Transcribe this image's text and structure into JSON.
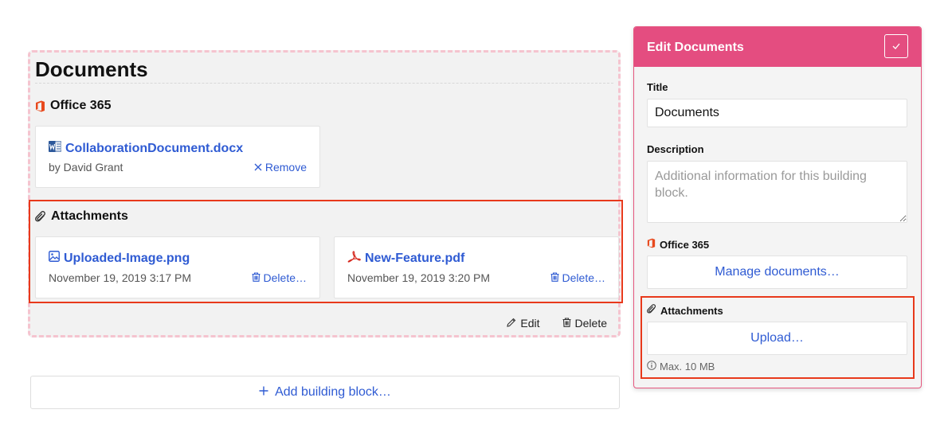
{
  "documents_block": {
    "title": "Documents",
    "office_section": {
      "heading": "Office 365",
      "icon": "office-365-icon",
      "items": [
        {
          "name": "CollaborationDocument.docx",
          "icon": "word-icon",
          "meta": "by David Grant",
          "action": "Remove",
          "action_icon": "close-icon"
        }
      ]
    },
    "attachments_section": {
      "heading": "Attachments",
      "icon": "paperclip-icon",
      "items": [
        {
          "name": "Uploaded-Image.png",
          "icon": "image-icon",
          "meta": "November 19, 2019 3:17 PM",
          "action": "Delete…",
          "action_icon": "trash-icon"
        },
        {
          "name": "New-Feature.pdf",
          "icon": "pdf-icon",
          "meta": "November 19, 2019 3:20 PM",
          "action": "Delete…",
          "action_icon": "trash-icon"
        }
      ]
    },
    "footer": {
      "edit_label": "Edit",
      "delete_label": "Delete"
    }
  },
  "add_block": {
    "label": "Add building block…"
  },
  "edit_panel": {
    "header_title": "Edit Documents",
    "title_label": "Title",
    "title_value": "Documents",
    "description_label": "Description",
    "description_placeholder": "Additional information for this building block.",
    "office_heading": "Office 365",
    "manage_button": "Manage documents…",
    "attachments_heading": "Attachments",
    "upload_button": "Upload…",
    "max_size_hint": "Max. 10 MB"
  },
  "colors": {
    "accent_pink": "#e44d80",
    "link_blue": "#2f5bd3",
    "highlight_red": "#e8391b",
    "office_orange": "#e8491d",
    "word_blue": "#2b579a",
    "pdf_red": "#d6281e"
  }
}
